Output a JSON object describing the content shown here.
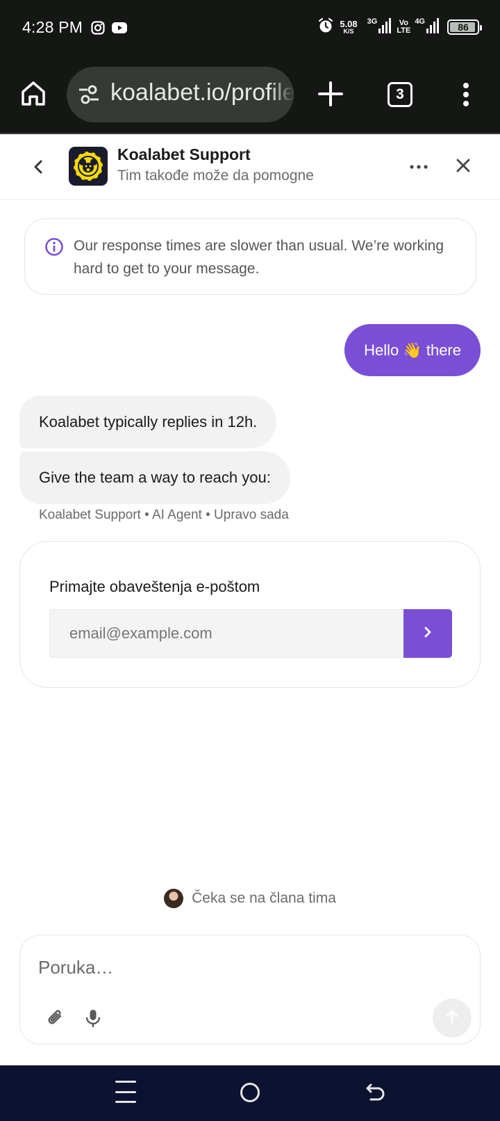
{
  "status_bar": {
    "time": "4:28 PM",
    "net_speed_value": "5.08",
    "net_speed_unit": "K/S",
    "sim1_type": "3G",
    "sim2_volte_top": "Vo",
    "sim2_volte_bottom": "LTE",
    "sim2_type": "4G",
    "battery_level": "86",
    "icons": [
      "instagram-icon",
      "youtube-icon",
      "alarm-icon",
      "signal-icon",
      "battery-icon"
    ]
  },
  "browser": {
    "url": "koalabet.io/profile",
    "tab_count": "3",
    "icons": [
      "home-icon",
      "site-settings-icon",
      "new-tab-icon",
      "tab-switcher-icon",
      "overflow-menu-icon"
    ]
  },
  "chat_header": {
    "title": "Koalabet Support",
    "subtitle": "Tim takođe može da pomogne",
    "icons": [
      "back-icon",
      "more-icon",
      "close-icon"
    ]
  },
  "notice": {
    "text": "Our response times are slower than usual. We’re working hard to get to your message.",
    "icon": "info-icon"
  },
  "messages": {
    "user": "Hello 👋 there",
    "bot": [
      "Koalabet typically replies in 12h.",
      "Give the team a way to reach you:"
    ],
    "meta": "Koalabet Support • AI Agent • Upravo sada"
  },
  "email_card": {
    "label": "Primajte obaveštenja e-poštom",
    "placeholder": "email@example.com",
    "value": "",
    "submit_icon": "chevron-right-icon"
  },
  "waiting": {
    "text": "Čeka se na člana tima"
  },
  "composer": {
    "placeholder": "Poruka…",
    "value": "",
    "icons": [
      "attachment-icon",
      "microphone-icon",
      "send-arrow-icon"
    ]
  },
  "nav_bar": {
    "icons": [
      "recent-apps-icon",
      "home-circle-icon",
      "back-gesture-icon"
    ]
  },
  "colors": {
    "accent": "#7a4fd6",
    "chrome_bg": "#141714",
    "urlbar_bg": "#363a36",
    "bot_bubble": "#f2f2f2",
    "navbar_bg": "#0d1230"
  }
}
